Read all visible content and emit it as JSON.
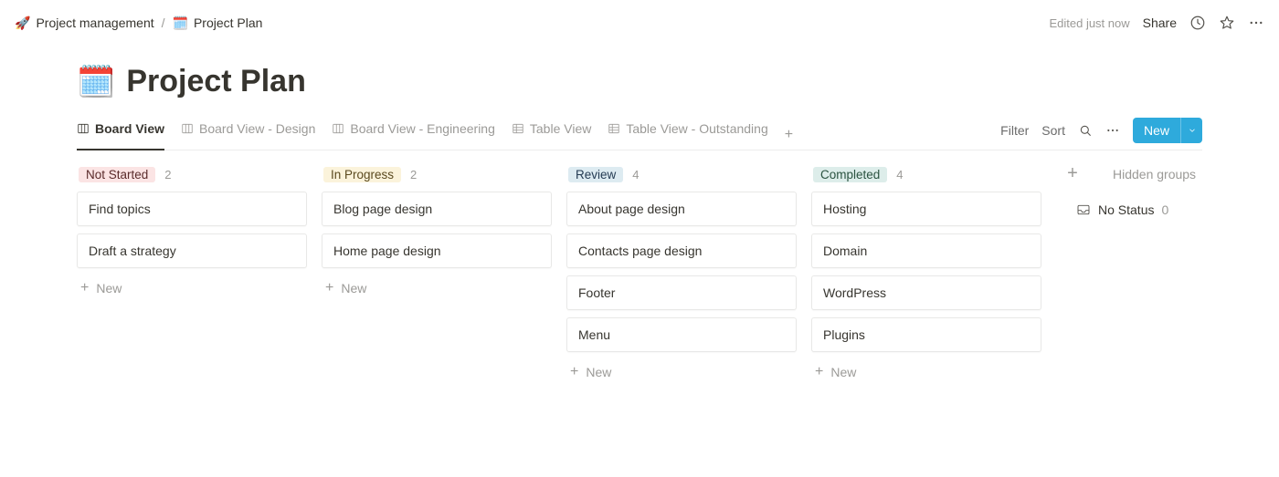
{
  "breadcrumb": {
    "parent_icon": "🚀",
    "parent_label": "Project management",
    "separator": "/",
    "page_icon": "🗓️",
    "page_label": "Project Plan"
  },
  "top": {
    "edited": "Edited just now",
    "share": "Share"
  },
  "page": {
    "icon": "🗓️",
    "title": "Project Plan"
  },
  "views": [
    {
      "label": "Board View",
      "type": "board",
      "active": true
    },
    {
      "label": "Board View - Design",
      "type": "board",
      "active": false
    },
    {
      "label": "Board View - Engineering",
      "type": "board",
      "active": false
    },
    {
      "label": "Table View",
      "type": "table",
      "active": false
    },
    {
      "label": "Table View - Outstanding",
      "type": "table",
      "active": false
    }
  ],
  "toolbar": {
    "filter": "Filter",
    "sort": "Sort",
    "new": "New"
  },
  "board": {
    "columns": [
      {
        "name": "Not Started",
        "tag_class": "tag-red",
        "count": "2",
        "cards": [
          "Find topics",
          "Draft a strategy"
        ]
      },
      {
        "name": "In Progress",
        "tag_class": "tag-yellow",
        "count": "2",
        "cards": [
          "Blog page design",
          "Home page design"
        ]
      },
      {
        "name": "Review",
        "tag_class": "tag-blue",
        "count": "4",
        "cards": [
          "About page design",
          "Contacts page design",
          "Footer",
          "Menu"
        ]
      },
      {
        "name": "Completed",
        "tag_class": "tag-green",
        "count": "4",
        "cards": [
          "Hosting",
          "Domain",
          "WordPress",
          "Plugins"
        ]
      }
    ],
    "new_card_label": "New",
    "hidden_groups_label": "Hidden groups",
    "no_status_label": "No Status",
    "no_status_count": "0"
  }
}
